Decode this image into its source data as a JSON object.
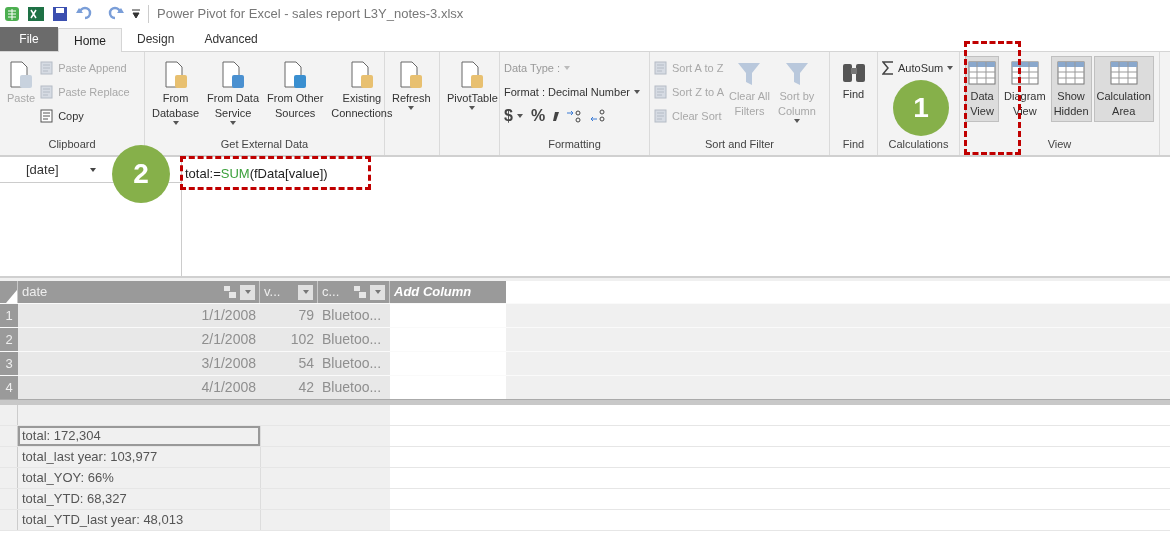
{
  "window": {
    "title": "Power Pivot for Excel - sales report L3Y_notes-3.xlsx"
  },
  "tabs": [
    {
      "label": "File",
      "kind": "file",
      "selected": false
    },
    {
      "label": "Home",
      "kind": "normal",
      "selected": true
    },
    {
      "label": "Design",
      "kind": "normal",
      "selected": false
    },
    {
      "label": "Advanced",
      "kind": "normal",
      "selected": false
    }
  ],
  "ribbon": {
    "groups": [
      {
        "label": "Clipboard",
        "items": [
          {
            "kind": "large",
            "label": "Paste",
            "disabled": true,
            "dropdown": false
          },
          {
            "kind": "small",
            "label": "Paste Append",
            "disabled": true,
            "dropdown": false
          },
          {
            "kind": "small",
            "label": "Paste Replace",
            "disabled": true,
            "dropdown": false
          },
          {
            "kind": "small",
            "label": "Copy",
            "disabled": false,
            "dropdown": false
          }
        ]
      },
      {
        "label": "Get External Data",
        "items": [
          {
            "kind": "large",
            "label": "From\nDatabase",
            "disabled": false,
            "dropdown": true
          },
          {
            "kind": "large",
            "label": "From Data\nService",
            "disabled": false,
            "dropdown": true
          },
          {
            "kind": "large",
            "label": "From Other\nSources",
            "disabled": false,
            "dropdown": false
          },
          {
            "kind": "large",
            "label": "Existing\nConnections",
            "disabled": false,
            "dropdown": false
          }
        ]
      },
      {
        "items": [
          {
            "kind": "large",
            "label": "Refresh",
            "disabled": false,
            "dropdown": true
          }
        ]
      },
      {
        "items": [
          {
            "kind": "large",
            "label": "PivotTable",
            "disabled": false,
            "dropdown": true
          }
        ]
      },
      {
        "label": "Formatting",
        "items": [
          {
            "kind": "field",
            "label": "Data Type :",
            "disabled": true,
            "dropdown": true
          },
          {
            "kind": "field",
            "label": "Format : Decimal Number",
            "disabled": false,
            "dropdown": true
          },
          {
            "kind": "symbol",
            "label": "$",
            "disabled": false,
            "dropdown": true
          },
          {
            "kind": "symbol",
            "label": "%",
            "disabled": false,
            "dropdown": false
          }
        ]
      },
      {
        "label": "Sort and Filter",
        "items": [
          {
            "kind": "small",
            "label": "Sort A to Z",
            "disabled": true,
            "dropdown": false
          },
          {
            "kind": "small",
            "label": "Sort Z to A",
            "disabled": true,
            "dropdown": false
          },
          {
            "kind": "small",
            "label": "Clear Sort",
            "disabled": true,
            "dropdown": false
          },
          {
            "kind": "large",
            "label": "Clear All\nFilters",
            "disabled": true,
            "dropdown": false
          },
          {
            "kind": "large",
            "label": "Sort by\nColumn",
            "disabled": true,
            "dropdown": true
          }
        ]
      },
      {
        "label": "Find",
        "items": [
          {
            "kind": "large",
            "label": "Find",
            "disabled": false,
            "dropdown": false
          }
        ]
      },
      {
        "label": "Calculations",
        "items": [
          {
            "kind": "small",
            "label": "AutoSum",
            "disabled": false,
            "dropdown": true
          }
        ]
      },
      {
        "label": "View",
        "items": [
          {
            "kind": "toggle",
            "label": "Data\nView",
            "selected": true
          },
          {
            "kind": "toggle",
            "label": "Diagram\nView",
            "selected": false
          },
          {
            "kind": "toggle",
            "label": "Show\nHidden",
            "selected": true
          },
          {
            "kind": "toggle",
            "label": "Calculation\nArea",
            "selected": true
          }
        ]
      }
    ]
  },
  "callouts": [
    "1",
    "2"
  ],
  "formula_bar": {
    "name_box": "[date]",
    "formula": [
      {
        "text": "total:=",
        "kind": "plain"
      },
      {
        "text": "SUM",
        "kind": "function"
      },
      {
        "text": "(fData[value])",
        "kind": "plain"
      }
    ]
  },
  "table": {
    "columns": [
      {
        "label": "date",
        "kind": "related"
      },
      {
        "label": "v...",
        "kind": "plain"
      },
      {
        "label": "c...",
        "kind": "related"
      }
    ],
    "add_column": "Add Column",
    "rows": [
      {
        "number": "1",
        "cells": [
          "1/1/2008",
          "79",
          "Bluetoo..."
        ]
      },
      {
        "number": "2",
        "cells": [
          "2/1/2008",
          "102",
          "Bluetoo..."
        ]
      },
      {
        "number": "3",
        "cells": [
          "3/1/2008",
          "54",
          "Bluetoo..."
        ]
      },
      {
        "number": "4",
        "cells": [
          "4/1/2008",
          "42",
          "Bluetoo..."
        ]
      }
    ]
  },
  "measures": [
    {
      "text": "total: 172,304",
      "selected": true
    },
    {
      "text": "total_last year: 103,977",
      "selected": false
    },
    {
      "text": "total_YOY: 66%",
      "selected": false
    },
    {
      "text": "total_YTD: 68,327",
      "selected": false
    },
    {
      "text": "total_YTD_last year: 48,013",
      "selected": false
    }
  ]
}
